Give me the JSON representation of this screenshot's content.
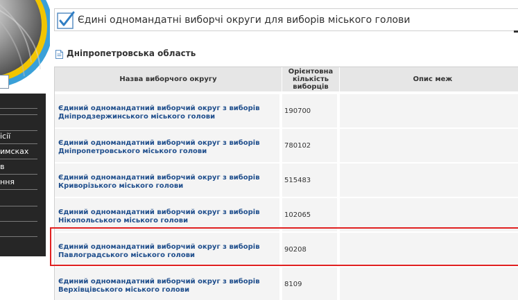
{
  "sidebar": {
    "menu_items": [
      "",
      "",
      "",
      "ісії",
      "имсках",
      "в",
      "ння",
      "",
      "",
      ""
    ]
  },
  "header": {
    "title": "Єдині одномандатні виборчі округи для виборів міського голови"
  },
  "region": {
    "name": "Дніпропетровська область"
  },
  "table": {
    "columns": {
      "name": "Назва виборчого округу",
      "count_lines": [
        "Орієнтовна",
        "кількість",
        "виборців"
      ],
      "description": "Опис меж"
    },
    "rows": [
      {
        "name_line1": "Єдиний одномандатний виборчий округ з виборів",
        "name_line2": "Дніпродзержинського міського голови",
        "count": "190700",
        "description": ""
      },
      {
        "name_line1": "Єдиний одномандатний виборчий округ з виборів",
        "name_line2": "Дніпропетровського міського голови",
        "count": "780102",
        "description": ""
      },
      {
        "name_line1": "Єдиний одномандатний виборчий округ з виборів",
        "name_line2": "Криворізького міського голови",
        "count": "515483",
        "description": ""
      },
      {
        "name_line1": "Єдиний одномандатний виборчий округ з виборів",
        "name_line2": "Нікопольського міського голови",
        "count": "102065",
        "description": ""
      },
      {
        "name_line1": "Єдиний одномандатний виборчий округ з виборів",
        "name_line2": "Павлоградського міського голови",
        "count": "90208",
        "description": ""
      },
      {
        "name_line1": "Єдиний одномандатний виборчий округ з виборів",
        "name_line2": "Верхівцівського міського голови",
        "count": "8109",
        "description": ""
      }
    ]
  },
  "colors": {
    "link": "#1f4e8c",
    "header_bg": "#e6e6e6",
    "row_bg": "#f4f4f4",
    "menu_bg": "#262626",
    "highlight": "#e02020",
    "logo_yellow": "#f2c500",
    "logo_blue": "#3aa0d8"
  },
  "icons": {
    "title": "checkbox-icon",
    "region": "document-icon"
  }
}
